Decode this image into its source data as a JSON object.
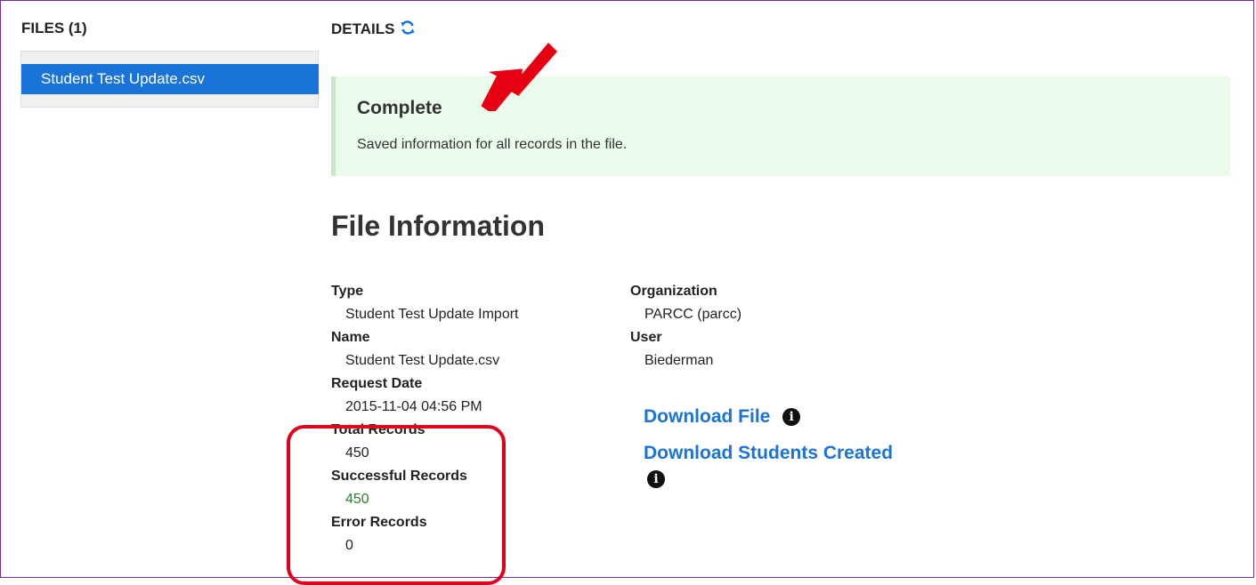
{
  "files": {
    "header": "FILES (1)",
    "items": [
      {
        "label": "Student Test Update.csv"
      }
    ]
  },
  "details": {
    "header": "DETAILS",
    "alert": {
      "title": "Complete",
      "message": "Saved information for all records in the file."
    },
    "section_title": "File Information",
    "left_fields": [
      {
        "label": "Type",
        "value": "Student Test Update Import"
      },
      {
        "label": "Name",
        "value": "Student Test Update.csv"
      },
      {
        "label": "Request Date",
        "value": "2015-11-04 04:56 PM"
      },
      {
        "label": "Total Records",
        "value": "450"
      },
      {
        "label": "Successful Records",
        "value": "450"
      },
      {
        "label": "Error Records",
        "value": "0"
      }
    ],
    "right_fields": [
      {
        "label": "Organization",
        "value": "PARCC (parcc)"
      },
      {
        "label": "User",
        "value": "Biederman"
      }
    ],
    "links": {
      "download_file": "Download File",
      "download_students_created": "Download Students Created"
    }
  },
  "colors": {
    "accent": "#1a73d9",
    "success_text": "#2e7d32",
    "alert_bg": "#eafaeb",
    "annotation": "#e0001b"
  },
  "icons": [
    "refresh-icon",
    "info-icon",
    "annotation-arrow"
  ]
}
